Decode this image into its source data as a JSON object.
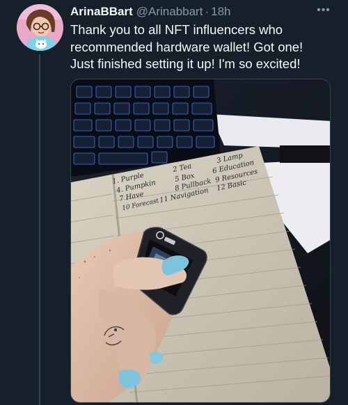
{
  "tweet": {
    "author_name": "ArinaBBart",
    "handle": "@Arinabbart",
    "separator": "·",
    "time": "18h",
    "more_label": "•••",
    "lines": [
      "Thank you to all NFT influencers who",
      "recommended hardware wallet! Got one!",
      "Just finished setting it up! I'm so excited!"
    ]
  },
  "photo": {
    "notebook_words": [
      "1. Purple",
      "2 Tea",
      "3 Lamp",
      "4. Pumpkin",
      "5 Box",
      "6 Education",
      "7 Have",
      "8 Pullback",
      "9 Resources",
      "10 Forecast",
      "11 Navigation",
      "12 Basic"
    ]
  },
  "colors": {
    "background": "#15202b",
    "primary_text": "#f7f9f9",
    "secondary_text": "#8b98a5",
    "border": "#38444d"
  }
}
